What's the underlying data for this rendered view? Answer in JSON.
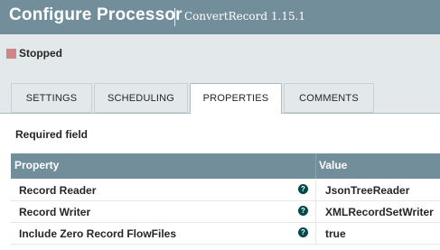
{
  "header": {
    "title": "Configure Processor",
    "subtitle": "ConvertRecord 1.15.1"
  },
  "status": {
    "text": "Stopped",
    "icon": "stopped-square-icon",
    "color": "#d18686"
  },
  "tabs": [
    {
      "label": "SETTINGS",
      "active": false
    },
    {
      "label": "SCHEDULING",
      "active": false
    },
    {
      "label": "PROPERTIES",
      "active": true
    },
    {
      "label": "COMMENTS",
      "active": false
    }
  ],
  "required_label": "Required field",
  "table": {
    "headers": {
      "property": "Property",
      "value": "Value"
    },
    "rows": [
      {
        "property": "Record Reader",
        "value": "JsonTreeReader",
        "help_icon": "question-circle-icon"
      },
      {
        "property": "Record Writer",
        "value": "XMLRecordSetWriter",
        "help_icon": "question-circle-icon"
      },
      {
        "property": "Include Zero Record FlowFiles",
        "value": "true",
        "help_icon": "question-circle-icon"
      }
    ]
  },
  "colors": {
    "header_bg": "#728e9b",
    "panel_bg": "#e3e8eb",
    "help_icon": "#004849"
  }
}
